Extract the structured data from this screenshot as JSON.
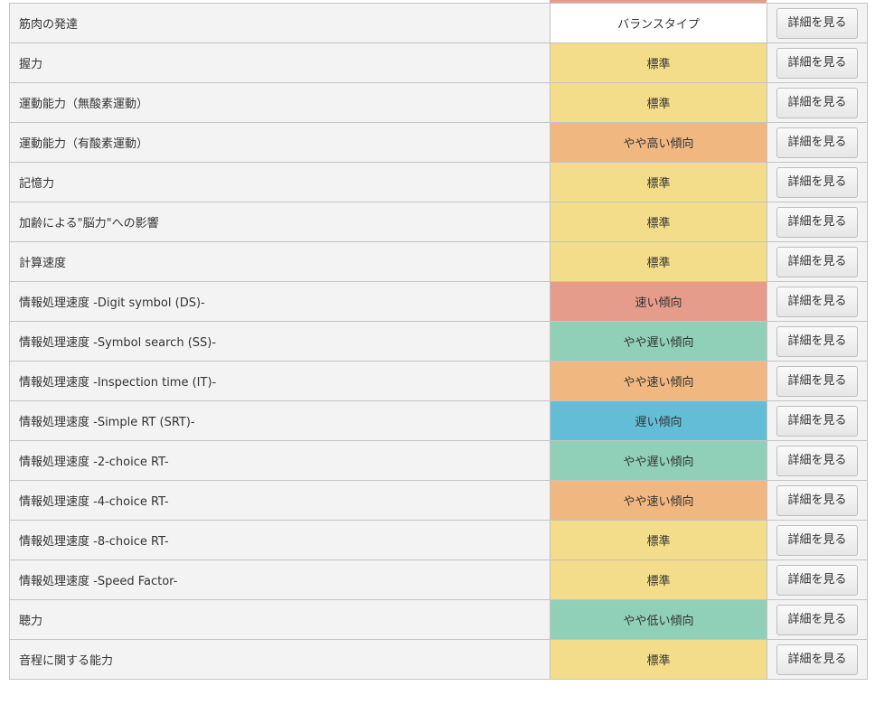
{
  "colors": {
    "standard": "#f3dc8a",
    "slightly_high": "#f0b880",
    "fast": "#e59c8b",
    "slightly_slow": "#90d0b8",
    "slow": "#64bdd7",
    "balance": "#ffffff",
    "top_strip": "#e59c8b"
  },
  "rows": [
    {
      "name": "筋肉の発達",
      "level": "バランスタイプ",
      "tone": "balance",
      "button": "詳細を見る"
    },
    {
      "name": "握力",
      "level": "標準",
      "tone": "standard",
      "button": "詳細を見る"
    },
    {
      "name": "運動能力（無酸素運動）",
      "level": "標準",
      "tone": "standard",
      "button": "詳細を見る"
    },
    {
      "name": "運動能力（有酸素運動）",
      "level": "やや高い傾向",
      "tone": "slightly_high",
      "button": "詳細を見る"
    },
    {
      "name": "記憶力",
      "level": "標準",
      "tone": "standard",
      "button": "詳細を見る"
    },
    {
      "name": "加齢による\"脳力\"への影響",
      "level": "標準",
      "tone": "standard",
      "button": "詳細を見る"
    },
    {
      "name": "計算速度",
      "level": "標準",
      "tone": "standard",
      "button": "詳細を見る"
    },
    {
      "name": "情報処理速度 -Digit symbol (DS)-",
      "level": "速い傾向",
      "tone": "fast",
      "button": "詳細を見る"
    },
    {
      "name": "情報処理速度 -Symbol search (SS)-",
      "level": "やや遅い傾向",
      "tone": "slightly_slow",
      "button": "詳細を見る"
    },
    {
      "name": "情報処理速度 -Inspection time (IT)-",
      "level": "やや速い傾向",
      "tone": "slightly_high",
      "button": "詳細を見る"
    },
    {
      "name": "情報処理速度 -Simple RT (SRT)-",
      "level": "遅い傾向",
      "tone": "slow",
      "button": "詳細を見る"
    },
    {
      "name": "情報処理速度 -2-choice RT-",
      "level": "やや遅い傾向",
      "tone": "slightly_slow",
      "button": "詳細を見る"
    },
    {
      "name": "情報処理速度 -4-choice RT-",
      "level": "やや速い傾向",
      "tone": "slightly_high",
      "button": "詳細を見る"
    },
    {
      "name": "情報処理速度 -8-choice RT-",
      "level": "標準",
      "tone": "standard",
      "button": "詳細を見る"
    },
    {
      "name": "情報処理速度 -Speed Factor-",
      "level": "標準",
      "tone": "standard",
      "button": "詳細を見る"
    },
    {
      "name": "聴力",
      "level": "やや低い傾向",
      "tone": "slightly_slow",
      "button": "詳細を見る"
    },
    {
      "name": "音程に関する能力",
      "level": "標準",
      "tone": "standard",
      "button": "詳細を見る"
    }
  ]
}
